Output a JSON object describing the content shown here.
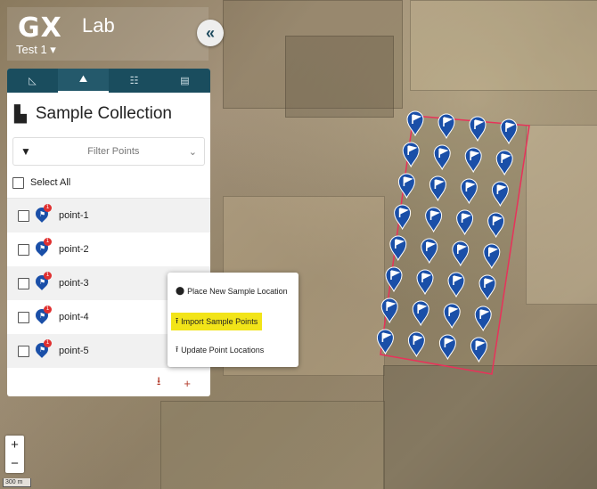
{
  "app": {
    "logo_main": "GX",
    "logo_sub": "Lab",
    "project": "Test 1 ▾"
  },
  "collapse": {
    "icon": "«"
  },
  "tabs": [
    {
      "icon": "ruler-icon",
      "glyph": "◺"
    },
    {
      "icon": "map-layers-icon",
      "glyph": "⛰"
    },
    {
      "icon": "sample-probe-icon",
      "glyph": "☷"
    },
    {
      "icon": "document-icon",
      "glyph": "▤"
    }
  ],
  "panel": {
    "title_icon": "▙",
    "title": "Sample Collection"
  },
  "filter": {
    "icon": "▼",
    "placeholder": "Filter Points",
    "chevron": "⌄"
  },
  "select_all": {
    "label": "Select All"
  },
  "points": [
    {
      "label": "point-1",
      "badge": "1"
    },
    {
      "label": "point-2",
      "badge": "1"
    },
    {
      "label": "point-3",
      "badge": "1"
    },
    {
      "label": "point-4",
      "badge": "1"
    },
    {
      "label": "point-5",
      "badge": "1"
    }
  ],
  "bottom": {
    "download_icon": "⭳",
    "add_icon": "+"
  },
  "popup": {
    "place_icon": "⬤",
    "place_label": "Place New Sample Location",
    "import_icon": "⭱",
    "import_label": "Import Sample Points",
    "update_icon": "⭱",
    "update_label": "Update Point Locations"
  },
  "zoom": {
    "in": "+",
    "out": "−"
  },
  "scale": {
    "label": "300 m"
  },
  "colors": {
    "panel_header": "#1a4d5e",
    "pin": "#1a4fa8",
    "badge": "#e03030",
    "boundary": "#e8325a",
    "highlight": "#f2e418",
    "action_icon": "#b23a2a"
  }
}
